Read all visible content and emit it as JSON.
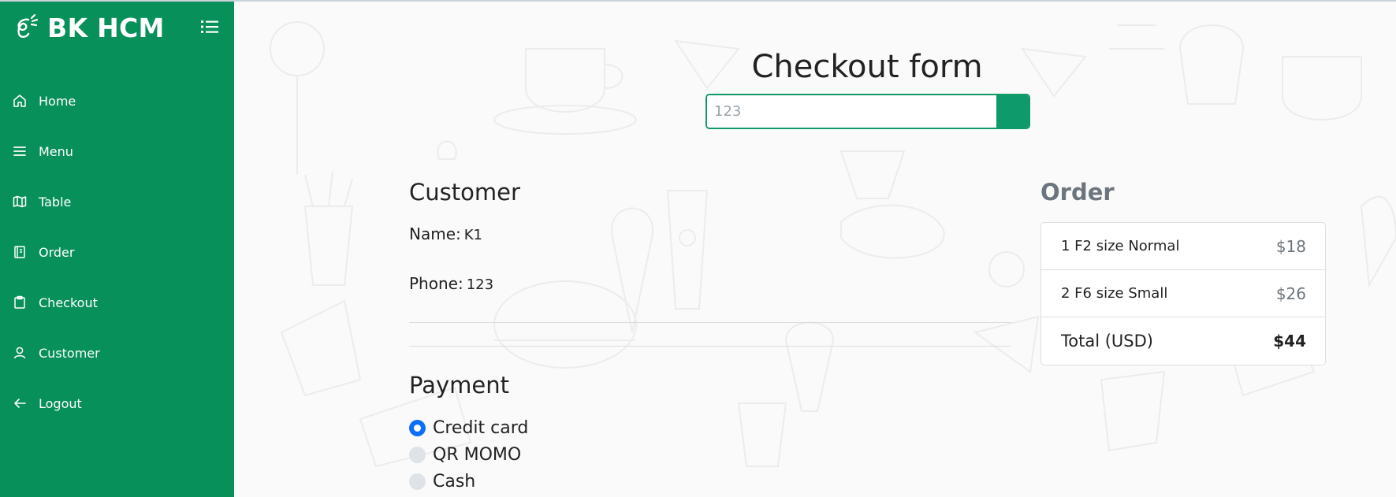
{
  "app": {
    "brand": "BK HCM",
    "accent": "#08905a"
  },
  "sidebar": {
    "items": [
      {
        "label": "Home",
        "icon": "home-icon"
      },
      {
        "label": "Menu",
        "icon": "menu-lines-icon"
      },
      {
        "label": "Table",
        "icon": "map-icon"
      },
      {
        "label": "Order",
        "icon": "book-icon"
      },
      {
        "label": "Checkout",
        "icon": "clipboard-icon"
      },
      {
        "label": "Customer",
        "icon": "user-icon"
      },
      {
        "label": "Logout",
        "icon": "arrow-left-icon"
      }
    ]
  },
  "page": {
    "title": "Checkout form",
    "search_placeholder": "123",
    "search_value": ""
  },
  "customer": {
    "heading": "Customer",
    "name_label": "Name:",
    "name_value": "K1",
    "phone_label": "Phone:",
    "phone_value": "123"
  },
  "payment": {
    "heading": "Payment",
    "options": [
      {
        "label": "Credit card",
        "selected": true
      },
      {
        "label": "QR MOMO",
        "selected": false
      },
      {
        "label": "Cash",
        "selected": false
      }
    ]
  },
  "order": {
    "heading": "Order",
    "items": [
      {
        "name": "1 F2 size Normal",
        "price": "$18"
      },
      {
        "name": "2 F6 size Small",
        "price": "$26"
      }
    ],
    "total_label": "Total (USD)",
    "total_value": "$44"
  }
}
